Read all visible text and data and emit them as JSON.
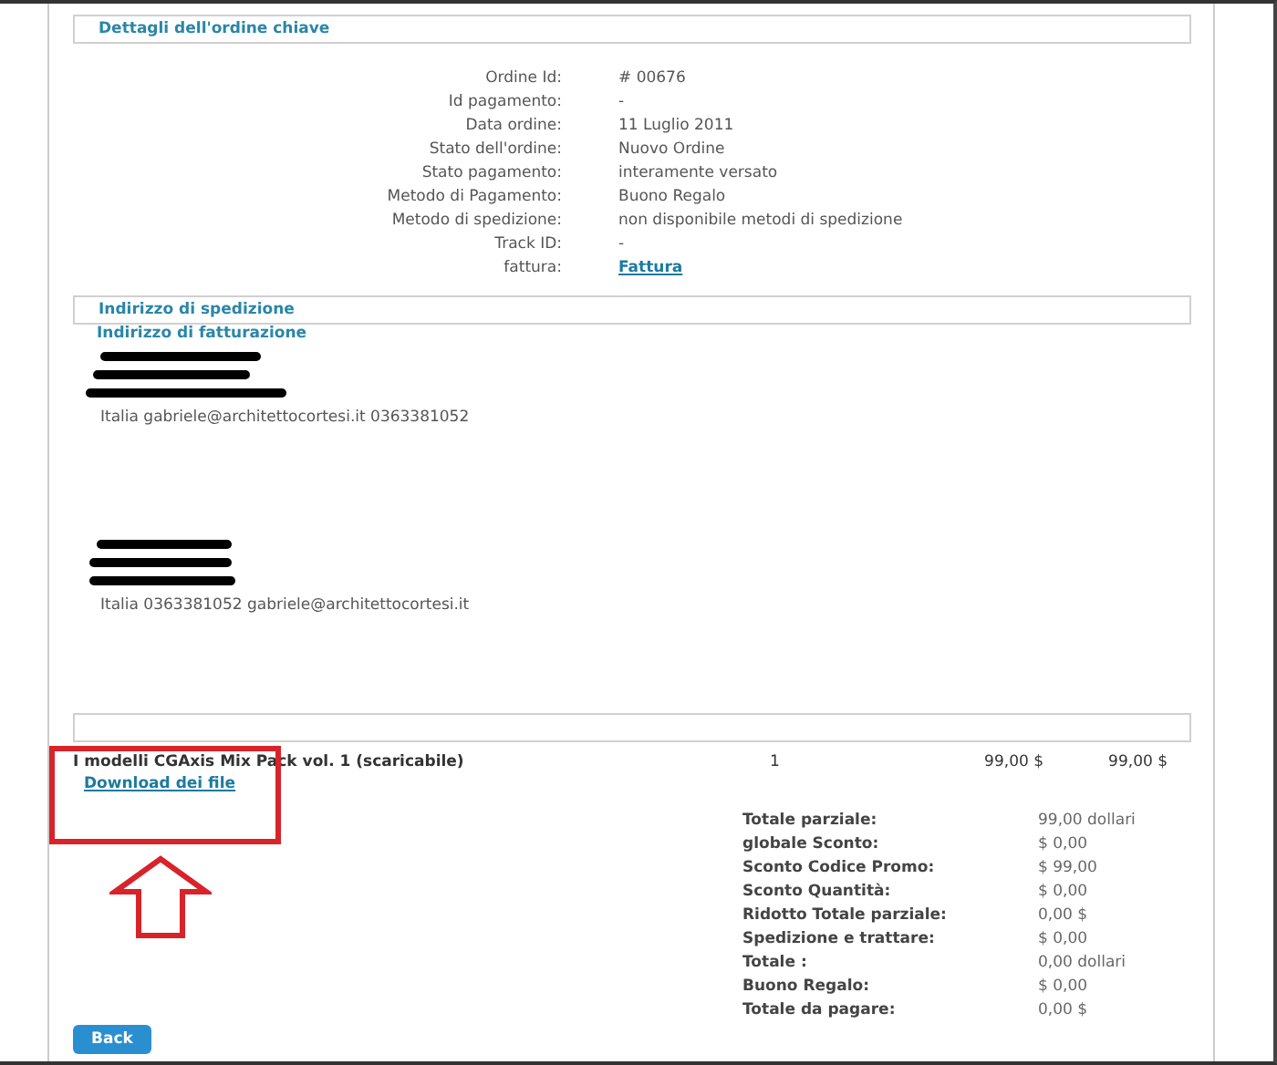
{
  "section_title": "Dettagli dell'ordine chiave",
  "details": [
    {
      "label": "Ordine Id:",
      "value": "# 00676",
      "kind": "text"
    },
    {
      "label": "Id pagamento:",
      "value": "-",
      "kind": "text"
    },
    {
      "label": "Data ordine:",
      "value": "11 Luglio 2011",
      "kind": "text"
    },
    {
      "label": "Stato dell'ordine:",
      "value": "Nuovo Ordine",
      "kind": "text"
    },
    {
      "label": "Stato pagamento:",
      "value": "interamente versato",
      "kind": "text"
    },
    {
      "label": "Metodo di Pagamento:",
      "value": "Buono Regalo",
      "kind": "text"
    },
    {
      "label": "Metodo di spedizione:",
      "value": "non disponibile metodi di spedizione",
      "kind": "text"
    },
    {
      "label": "Track ID:",
      "value": "-",
      "kind": "text"
    },
    {
      "label": "fattura:",
      "value": "Fattura",
      "kind": "link"
    }
  ],
  "shipping_title": "Indirizzo di spedizione",
  "billing_title": "Indirizzo di fatturazione",
  "addresses": [
    {
      "contact": "Italia gabriele@architettocortesi.it 0363381052"
    },
    {
      "contact": "Italia 0363381052 gabriele@architettocortesi.it"
    }
  ],
  "items": [
    {
      "name": "I modelli CGAxis Mix Pack vol. 1 (scaricabile)",
      "link": "Download dei file",
      "qty": "1",
      "price": "99,00 $",
      "total": "99,00 $"
    }
  ],
  "totals": [
    {
      "label": "Totale parziale:",
      "value": "99,00 dollari"
    },
    {
      "label": "globale Sconto:",
      "value": "$ 0,00"
    },
    {
      "label": "Sconto Codice Promo:",
      "value": "$ 99,00"
    },
    {
      "label": "Sconto Quantità:",
      "value": "$ 0,00"
    },
    {
      "label": "Ridotto Totale parziale:",
      "value": "0,00 $"
    },
    {
      "label": "Spedizione e trattare:",
      "value": "$ 0,00"
    },
    {
      "label": "Totale :",
      "value": "0,00 dollari"
    },
    {
      "label": "Buono Regalo:",
      "value": "$ 0,00"
    },
    {
      "label": "Totale da pagare:",
      "value": "0,00 $"
    }
  ],
  "back_button": "Back"
}
